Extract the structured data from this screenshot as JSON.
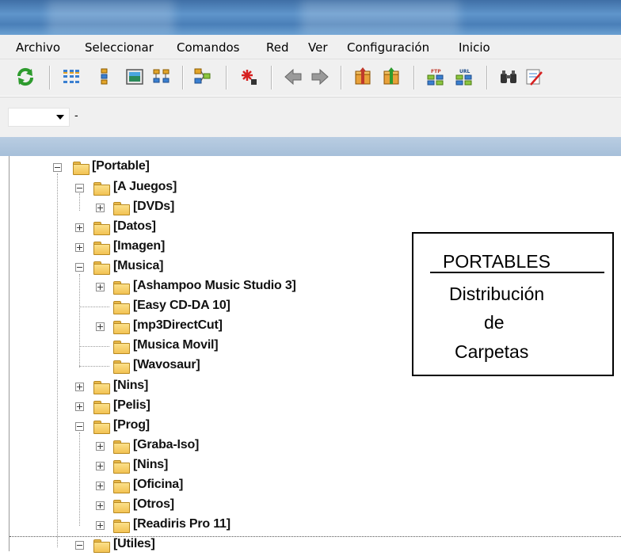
{
  "menu": {
    "items": [
      "Archivo",
      "Seleccionar",
      "Comandos",
      "Red",
      "Ver",
      "Configuración",
      "Inicio"
    ]
  },
  "toolbar": {
    "icons": [
      "refresh-icon",
      "brief-view-icon",
      "detailed-view-icon",
      "thumbnail-view-icon",
      "tree-view-icon",
      "compare-icon",
      "new-file-icon",
      "back-icon",
      "forward-icon",
      "pack-icon",
      "unpack-icon",
      "ftp-connect-icon",
      "url-connect-icon",
      "search-icon",
      "multi-rename-icon"
    ],
    "ftp_label": "FTP",
    "url_label": "URL"
  },
  "drive": {
    "selected": "",
    "info": "-"
  },
  "tree": {
    "root": "[Portable]",
    "a_juegos": "[A Juegos]",
    "dvds": "[DVDs]",
    "datos": "[Datos]",
    "imagen": "[Imagen]",
    "musica": "[Musica]",
    "ashampoo": "[Ashampoo Music Studio 3]",
    "easycd": "[Easy CD-DA 10]",
    "mp3": "[mp3DirectCut]",
    "musicamovil": "[Musica Movil]",
    "wavosaur": "[Wavosaur]",
    "nins": "[Nins]",
    "pelis": "[Pelis]",
    "prog": "[Prog]",
    "grabaiso": "[Graba-Iso]",
    "nins2": "[Nins]",
    "oficina": "[Oficina]",
    "otros": "[Otros]",
    "readiris": "[Readiris Pro 11]",
    "utiles": "[Utiles]"
  },
  "callout": {
    "title": "PORTABLES",
    "line1": "Distribución",
    "line2": "de",
    "line3": "Carpetas"
  },
  "colors": {
    "titlebar": "#4a7fb8",
    "folder": "#f2c253",
    "header_band": "#a6bfd9"
  }
}
